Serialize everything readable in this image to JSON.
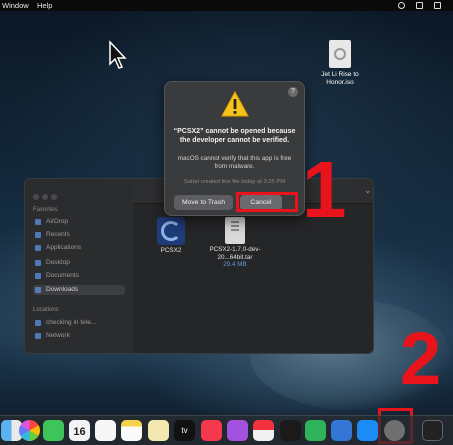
{
  "menubar": {
    "items": [
      "Window",
      "Help"
    ]
  },
  "desktop_file": {
    "name": "Jet Li Rise to Honor.iso"
  },
  "dialog": {
    "title": "“PCSX2” cannot be opened because the developer cannot be verified.",
    "message": "macOS cannot verify that this app is free from malware.",
    "note": "Safari created this file today at 3:25 PM",
    "help": "?",
    "move_to_trash_label": "Move to Trash",
    "cancel_label": "Cancel"
  },
  "finder": {
    "sidebar_heading_favorites": "Favorites",
    "favorites": [
      "AirDrop",
      "Recents",
      "Applications",
      "Desktop",
      "Documents",
      "Downloads"
    ],
    "active_item": "Downloads",
    "sidebar_heading_locations": "Locations",
    "locations": [
      "checking in tele...",
      "Network"
    ],
    "files": [
      {
        "name": "PCSX2",
        "sub": ""
      },
      {
        "name": "PCSX2-1.7.0-dev-20...64bit.tar",
        "sub": "29.4 MB"
      }
    ],
    "nav_chevrons": ">>"
  },
  "annotations": {
    "step1": "1",
    "step2": "2",
    "color": "#e8131b"
  },
  "dock": {
    "calendar_day": "16",
    "tv_label": "tv",
    "icons": [
      "finder-icon",
      "photos-icon",
      "facetime-icon",
      "calendar-icon",
      "reminders-icon",
      "notes-icon",
      "tv-icon",
      "music-icon",
      "podcasts-icon",
      "news-icon",
      "stocks-icon",
      "numbers-icon",
      "keynote-icon",
      "appstore-icon",
      "pcsx2-icon",
      "terminal-icon"
    ]
  }
}
